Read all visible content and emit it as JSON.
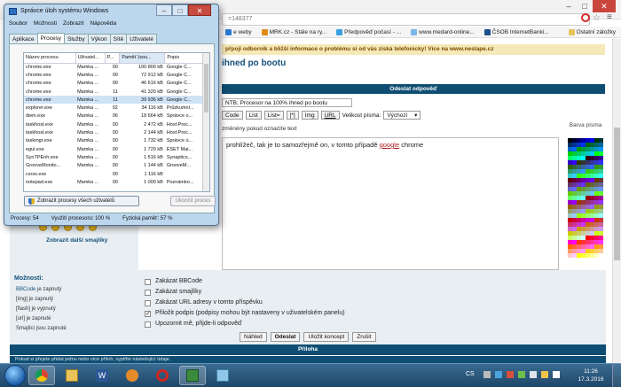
{
  "browser": {
    "url_fragment": "=148377",
    "bookmarks": [
      {
        "label": "e weby",
        "color": "#2a7bd0"
      },
      {
        "label": "MRK.cz - Stále na ry...",
        "color": "#e08a1a"
      },
      {
        "label": "Předpověď počasí - ...",
        "color": "#3a9fe0"
      },
      {
        "label": "www.medard-online...",
        "color": "#7bb6e8"
      },
      {
        "label": "ČSOB InternetBanki...",
        "color": "#1b4f8c"
      }
    ],
    "bookmarks_folder": "Ostatní záložky",
    "notice": "přpojí odborník a bližší informace o problému si od vás získá telefonicky! Více na www.neslape.cz",
    "page_title": "ihned po bootu",
    "reply_header": "Odeslat odpověď",
    "subject_value": "NTB, Procesor na 100% ihned po bootu",
    "toolbar_buttons": [
      "Code",
      "List",
      "List=",
      "[*]",
      "Img",
      "URL"
    ],
    "font_size_label": "Velikost písma:",
    "font_size_value": "Výchozí",
    "change_hint": "změněny pokud označíte text",
    "editor_text_before": "prohlížeč, tak je to samozřejmě on, v tomto případě ",
    "editor_keyword": "google",
    "editor_text_after": " chrome",
    "color_label": "Barva písma",
    "more_smileys": "Zobrazit další smajlíky",
    "options_title": "Možnosti:",
    "options": [
      {
        "hl": "BBCode",
        "rest": " je zapnutý"
      },
      {
        "hl": "[img]",
        "rest": " je zapnutý"
      },
      {
        "hl": "[flash]",
        "rest": " je vypnutý"
      },
      {
        "hl": "[url]",
        "rest": " je zapnuté"
      },
      {
        "hl": "Smajlíci",
        "rest": " jsou zapnuté"
      }
    ],
    "checkboxes": [
      {
        "label": "Zakázat BBCode",
        "checked": false
      },
      {
        "label": "Zakázat smajlíky",
        "checked": false
      },
      {
        "label": "Zakázat URL adresy v tomto příspěvku",
        "checked": false
      },
      {
        "label": "Přiložit podpis (podpisy mohou být nastaveny v uživatelském panelu)",
        "checked": true
      },
      {
        "label": "Upozornit mě, přijde-li odpověď",
        "checked": false
      }
    ],
    "form_buttons": [
      "Náhled",
      "Odeslat",
      "Uložit koncept",
      "Zrušit"
    ],
    "attachment_header": "Příloha",
    "attachment_note": "Pokud si přejete přidat jednu nebo více příloh, vyplňte následující údaje."
  },
  "taskmgr": {
    "title": "Správce úloh systému Windows",
    "menu": [
      "Soubor",
      "Možnosti",
      "Zobrazit",
      "Nápověda"
    ],
    "tabs": [
      "Aplikace",
      "Procesy",
      "Služby",
      "Výkon",
      "Sítě",
      "Uživatelé"
    ],
    "active_tab": 1,
    "columns": [
      "Název procesu",
      "Uživatel...",
      "P...",
      "Paměť (sou...",
      "Popis"
    ],
    "rows": [
      [
        "chrome.exe",
        "Mamka ...",
        "00",
        "100 800 kB",
        "Google C..."
      ],
      [
        "chrome.exe",
        "Mamka ...",
        "00",
        "72 912 kB",
        "Google C..."
      ],
      [
        "chrome.exe",
        "Mamka ...",
        "00",
        "46 616 kB",
        "Google C..."
      ],
      [
        "chrome.exe",
        "Mamka ...",
        "11",
        "41 320 kB",
        "Google C..."
      ],
      [
        "chrome.exe",
        "Mamka ...",
        "11",
        "39 936 kB",
        "Google C..."
      ],
      [
        "explorer.exe",
        "Mamka ...",
        "02",
        "34 116 kB",
        "Průzkumní..."
      ],
      [
        "dwm.exe",
        "Mamka ...",
        "06",
        "18 664 kB",
        "Správce o..."
      ],
      [
        "taskhost.exe",
        "Mamka ...",
        "00",
        "2 472 kB",
        "Host Proc..."
      ],
      [
        "taskhost.exe",
        "Mamka ...",
        "00",
        "2 144 kB",
        "Host Proc..."
      ],
      [
        "taskmgr.exe",
        "Mamka ...",
        "00",
        "1 732 kB",
        "Správce ú..."
      ],
      [
        "egui.exe",
        "Mamka ...",
        "00",
        "1 720 kB",
        "ESET Mai..."
      ],
      [
        "SynTPEnh.exe",
        "Mamka ...",
        "00",
        "1 516 kB",
        "Synaptics..."
      ],
      [
        "GrooveMonito...",
        "Mamka ...",
        "00",
        "1 144 kB",
        "GrooveM..."
      ],
      [
        "csrss.exe",
        "",
        "00",
        "1 116 kB",
        ""
      ],
      [
        "notepad.exe",
        "Mamka ...",
        "00",
        "1 000 kB",
        "Poznámko..."
      ]
    ],
    "selected_row": 4,
    "show_all_button": "Zobrazit procesy všech uživatelů",
    "end_process_button": "Ukončit proces",
    "status_processes": "Procesy: 54",
    "status_cpu": "Využití procesoru: 100 %",
    "status_memory": "Fyzická paměť: 57 %"
  },
  "taskbar": {
    "language": "CS",
    "time": "11:26",
    "date": "17.3.2016"
  }
}
